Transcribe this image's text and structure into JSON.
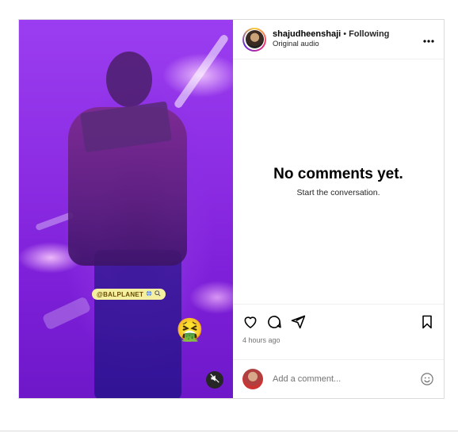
{
  "post": {
    "media": {
      "watermark_text": "@BALPLANET",
      "emoji": "🤮",
      "mute_icon": "volume-muted-icon"
    },
    "header": {
      "username": "shajudheenshaji",
      "separator": "•",
      "follow_status": "Following",
      "subtitle": "Original audio",
      "more_icon": "more-horizontal-icon",
      "more_label": "..."
    },
    "comments": {
      "empty_title": "No comments yet.",
      "empty_subtitle": "Start the conversation."
    },
    "actions": {
      "icons": [
        "heart-icon",
        "comment-icon",
        "share-icon",
        "bookmark-icon"
      ],
      "timestamp": "4 hours ago"
    },
    "comment_bar": {
      "placeholder": "Add a comment...",
      "emoji_icon": "emoji-icon"
    }
  },
  "colors": {
    "border": "#dbdbdb",
    "muted_text": "#737373",
    "media_purple": "#8a2be2"
  }
}
